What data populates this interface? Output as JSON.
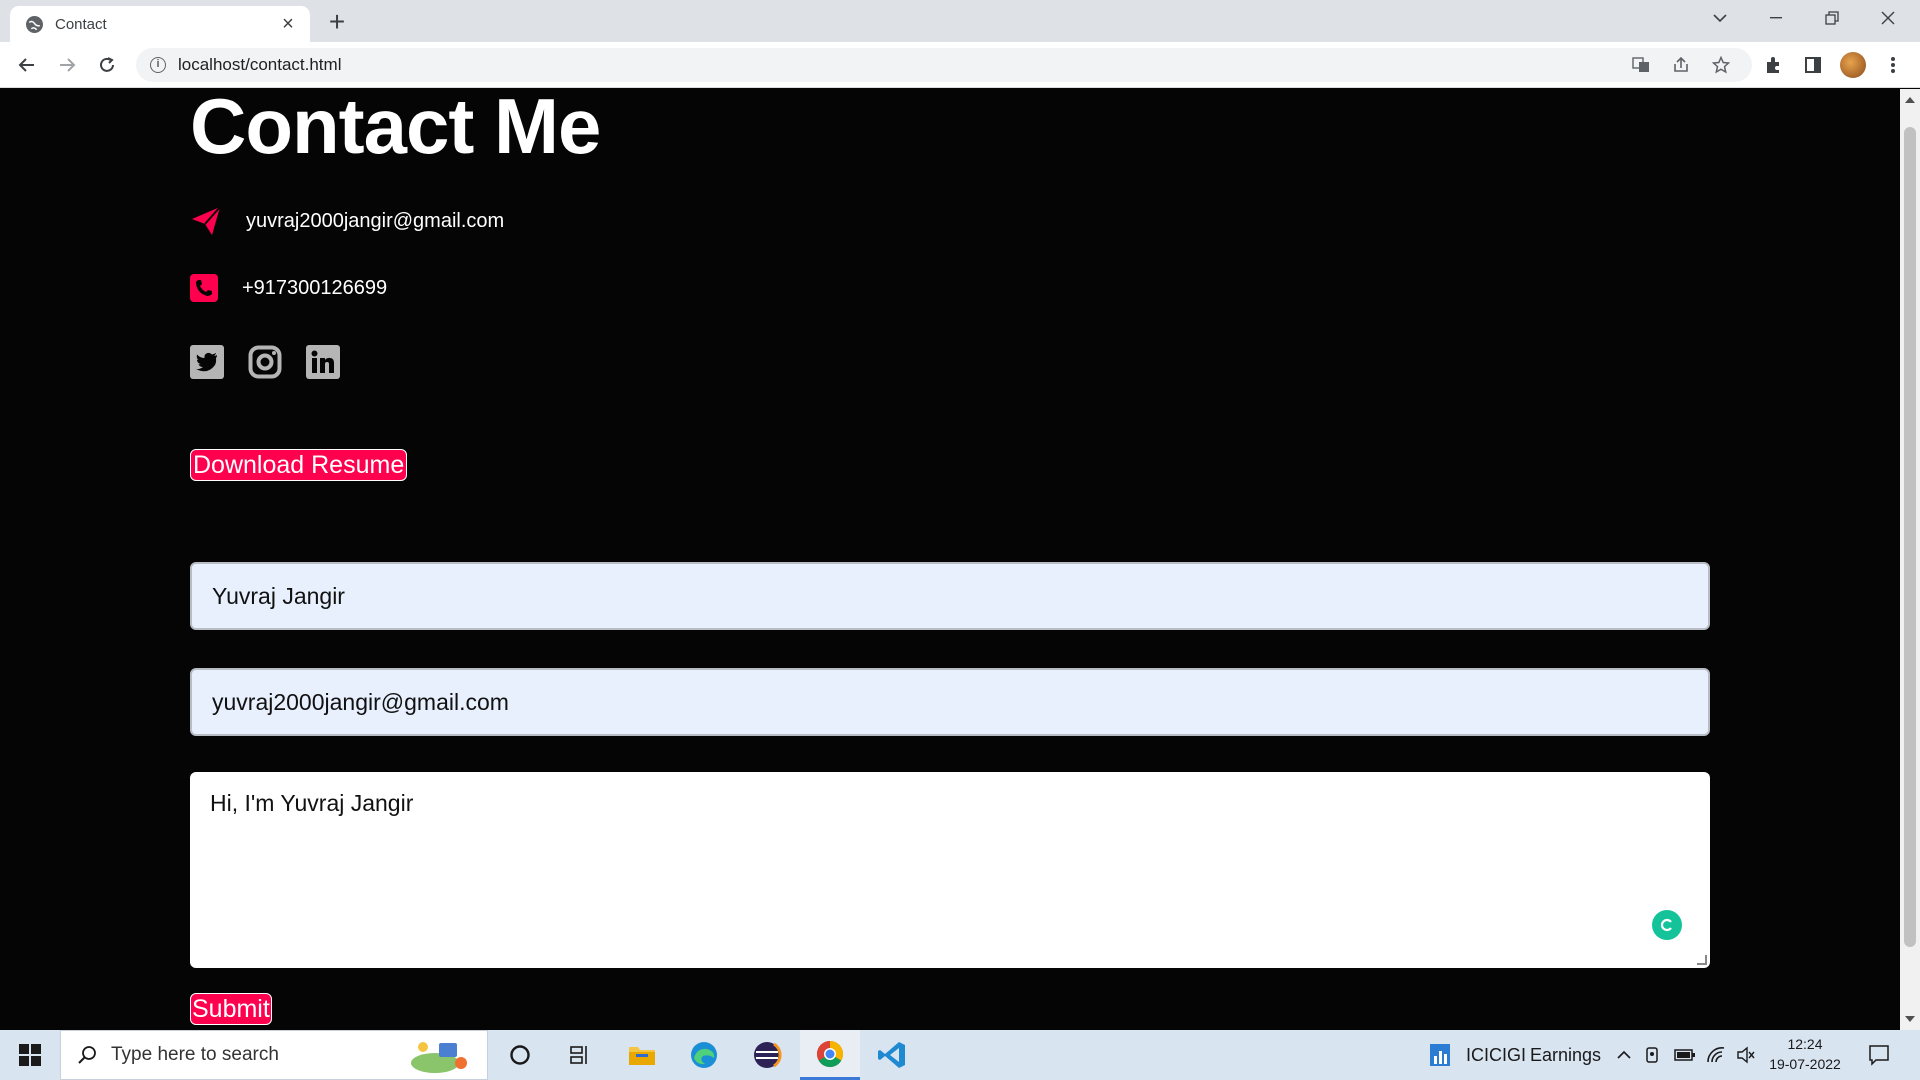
{
  "browser": {
    "tab_title": "Contact",
    "url": "localhost/contact.html"
  },
  "page": {
    "heading": "Contact Me",
    "email": "yuvraj2000jangir@gmail.com",
    "phone": "+917300126699",
    "social_icons": [
      "twitter-icon",
      "instagram-icon",
      "linkedin-icon"
    ],
    "resume_button": "Download Resume",
    "form": {
      "name_value": "Yuvraj Jangir",
      "email_value": "yuvraj2000jangir@gmail.com",
      "message_value": "Hi, I'm Yuvraj Jangir",
      "submit_label": "Submit"
    },
    "accent_color": "#ff004f"
  },
  "taskbar": {
    "search_placeholder": "Type here to search",
    "tray_stock_name": "ICICIGI",
    "tray_stock_label": "Earnings",
    "time": "12:24",
    "date": "19-07-2022"
  }
}
